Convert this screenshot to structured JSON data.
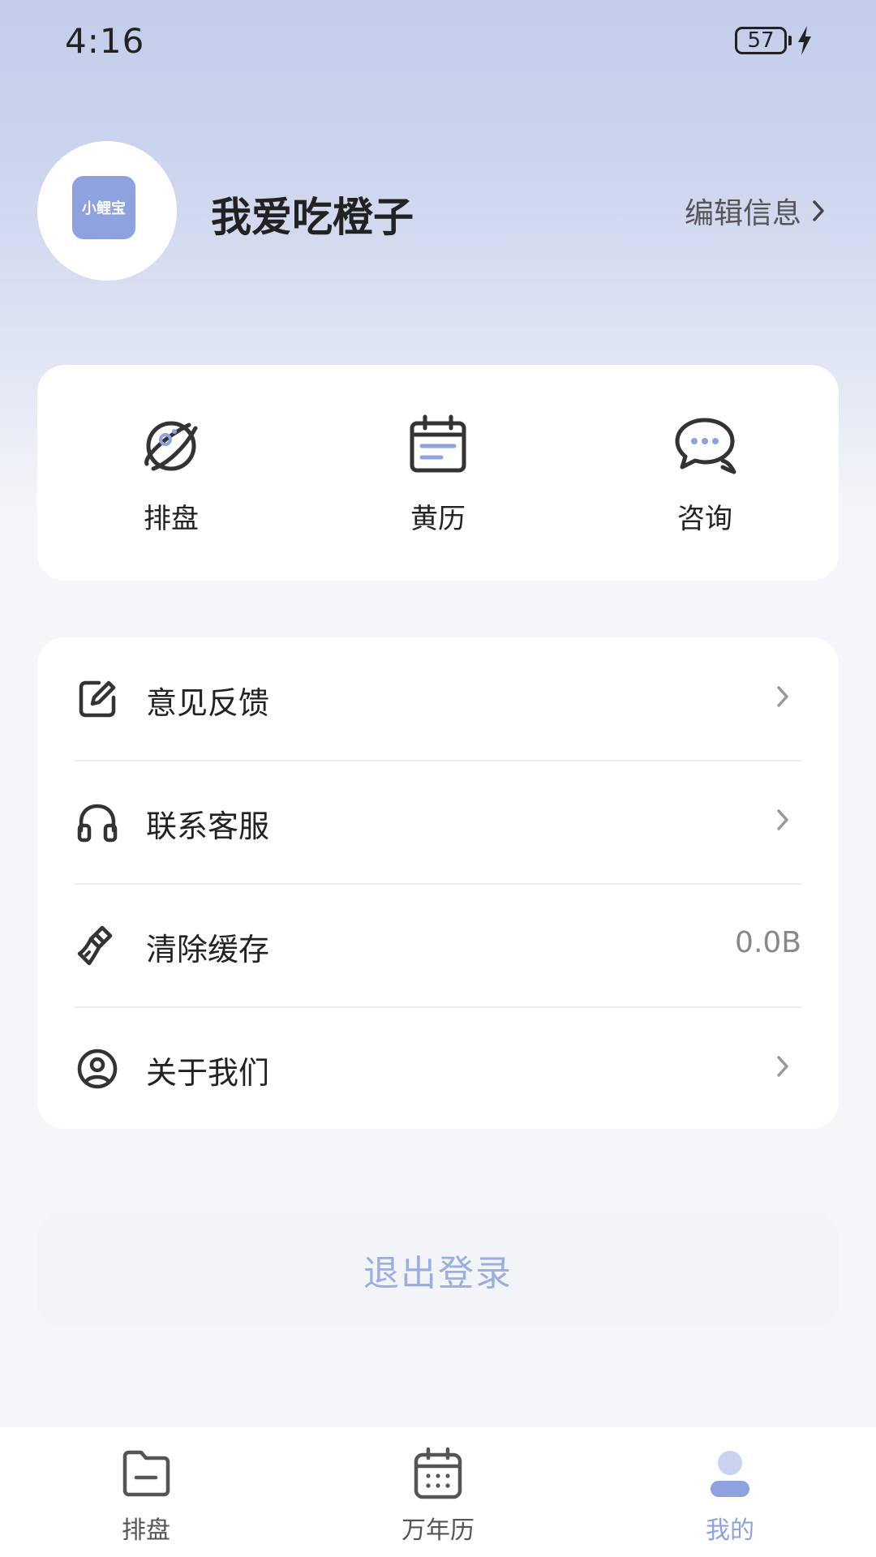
{
  "status_bar": {
    "time": "4:16",
    "battery_level": "57"
  },
  "profile": {
    "avatar_logo_text": "小鲤宝",
    "username": "我爱吃橙子",
    "edit_label": "编辑信息"
  },
  "quick_actions": [
    {
      "label": "排盘",
      "icon": "planet-icon"
    },
    {
      "label": "黄历",
      "icon": "calendar-icon"
    },
    {
      "label": "咨询",
      "icon": "chat-bubbles-icon"
    }
  ],
  "menu": [
    {
      "label": "意见反馈",
      "icon": "edit-icon",
      "value": ""
    },
    {
      "label": "联系客服",
      "icon": "headset-icon",
      "value": ""
    },
    {
      "label": "清除缓存",
      "icon": "broom-icon",
      "value": "0.0B"
    },
    {
      "label": "关于我们",
      "icon": "user-circle-icon",
      "value": ""
    }
  ],
  "logout_label": "退出登录",
  "tabbar": {
    "tabs": [
      {
        "label": "排盘",
        "icon": "folder-icon"
      },
      {
        "label": "万年历",
        "icon": "calendar-grid-icon"
      },
      {
        "label": "我的",
        "icon": "person-icon"
      }
    ],
    "active_index": 2
  },
  "colors": {
    "accent": "#8fa2e0",
    "header_gradient_top": "#c3cdea",
    "page_background": "#f5f6f9",
    "text_primary": "#222222",
    "text_secondary": "#888888"
  }
}
